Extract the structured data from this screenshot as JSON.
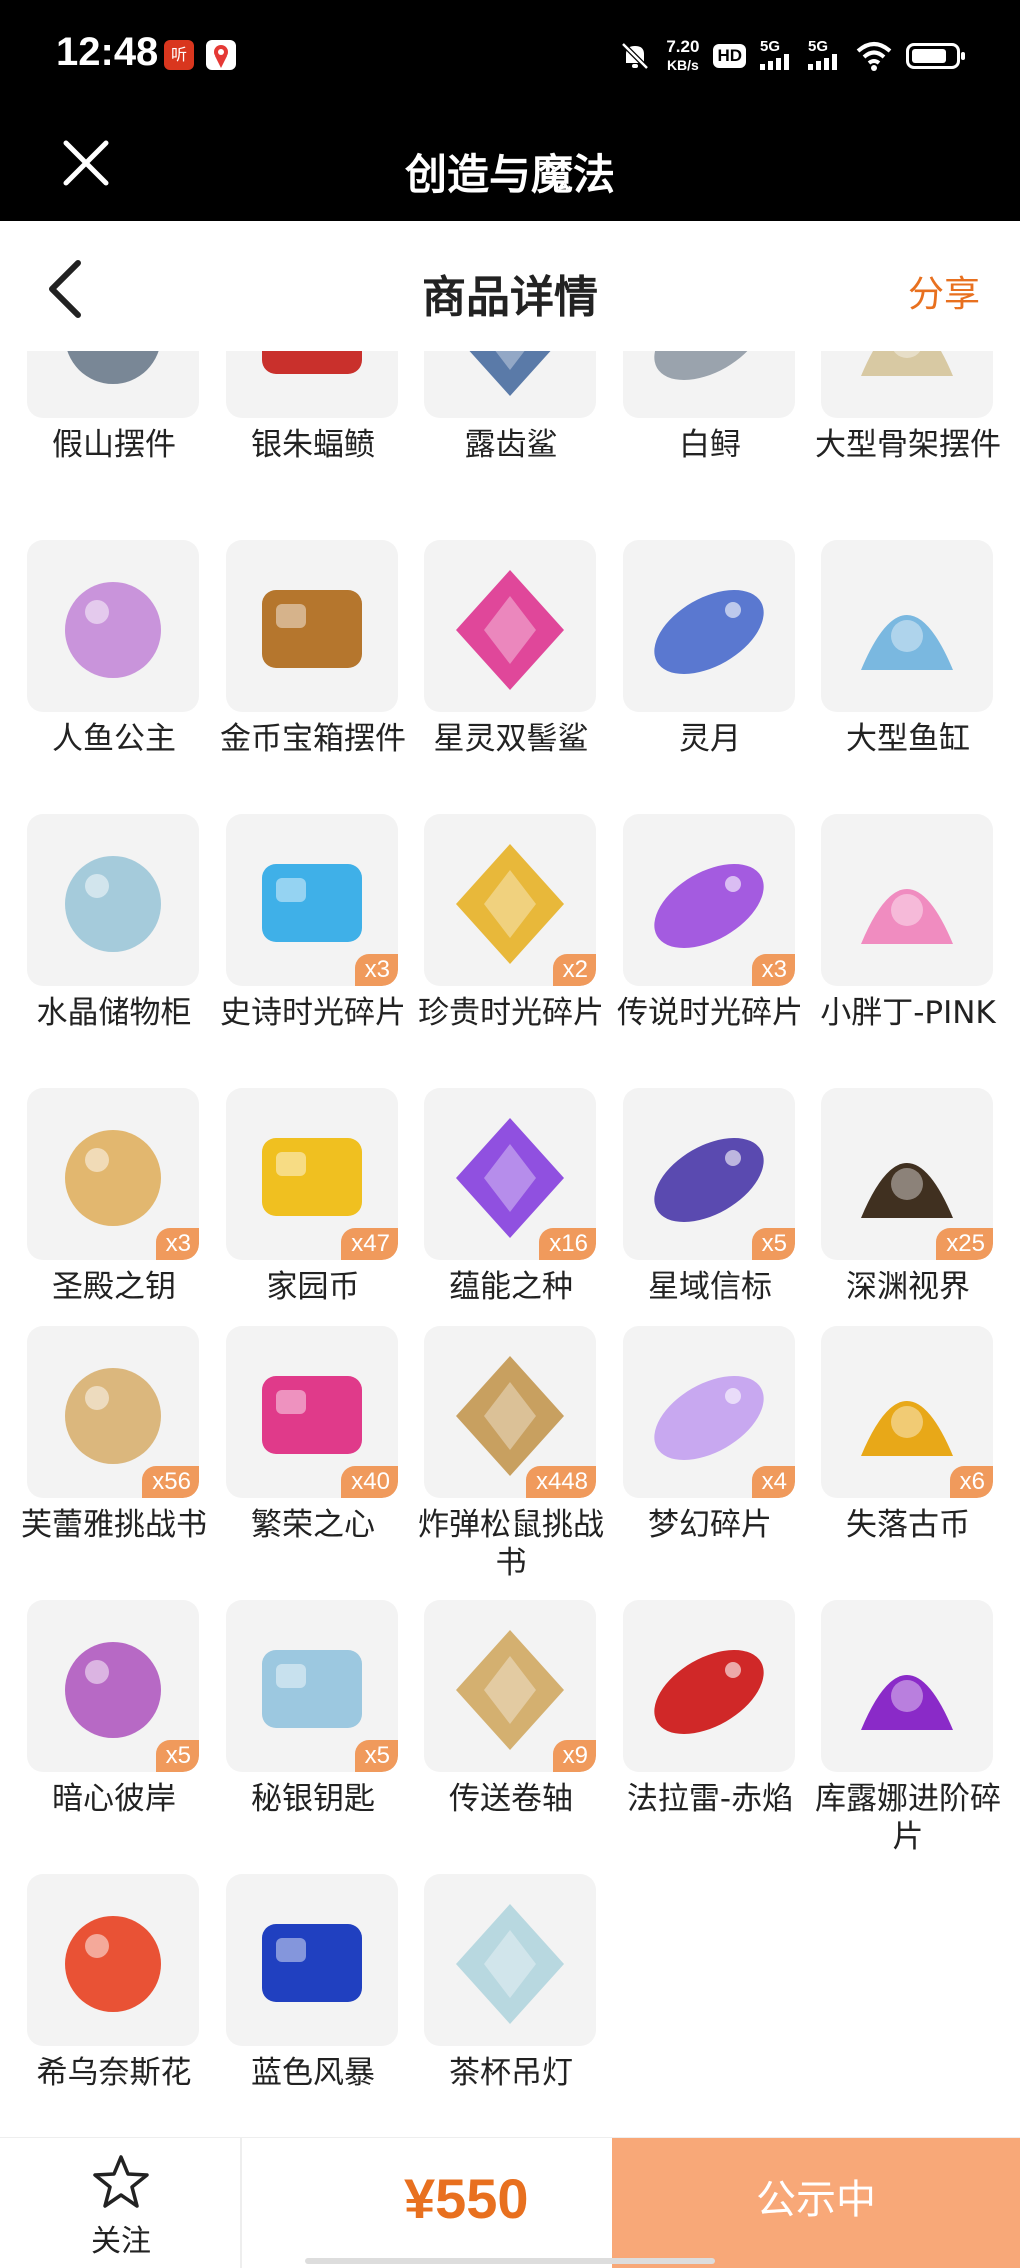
{
  "status_bar": {
    "time": "12:48",
    "net_speed_value": "7.20",
    "net_speed_unit": "KB/s",
    "hd_label": "HD",
    "signal_labels": [
      "5G",
      "5G"
    ],
    "icons": [
      "app-notification-icon",
      "maps-notification-icon",
      "mute-bell-icon",
      "wifi-icon",
      "battery-icon"
    ]
  },
  "app_bar": {
    "title": "创造与魔法"
  },
  "header": {
    "title": "商品详情",
    "share_label": "分享"
  },
  "items": [
    {
      "name": "假山摆件",
      "qty": ""
    },
    {
      "name": "银朱蝠鲼",
      "qty": ""
    },
    {
      "name": "露齿鲨",
      "qty": ""
    },
    {
      "name": "白鲟",
      "qty": ""
    },
    {
      "name": "大型骨架摆件",
      "qty": ""
    },
    {
      "name": "人鱼公主",
      "qty": ""
    },
    {
      "name": "金币宝箱摆件",
      "qty": ""
    },
    {
      "name": "星灵双髻鲨",
      "qty": ""
    },
    {
      "name": "灵月",
      "qty": ""
    },
    {
      "name": "大型鱼缸",
      "qty": ""
    },
    {
      "name": "水晶储物柜",
      "qty": ""
    },
    {
      "name": "史诗时光碎片",
      "qty": "x3"
    },
    {
      "name": "珍贵时光碎片",
      "qty": "x2"
    },
    {
      "name": "传说时光碎片",
      "qty": "x3"
    },
    {
      "name": "小胖丁-PINK",
      "qty": ""
    },
    {
      "name": "圣殿之钥",
      "qty": "x3"
    },
    {
      "name": "家园币",
      "qty": "x47"
    },
    {
      "name": "蕴能之种",
      "qty": "x16"
    },
    {
      "name": "星域信标",
      "qty": "x5"
    },
    {
      "name": "深渊视界",
      "qty": "x25"
    },
    {
      "name": "芙蕾雅挑战书",
      "qty": "x56"
    },
    {
      "name": "繁荣之心",
      "qty": "x40"
    },
    {
      "name": "炸弹松鼠挑战书",
      "qty": "x448"
    },
    {
      "name": "梦幻碎片",
      "qty": "x4"
    },
    {
      "name": "失落古币",
      "qty": "x6"
    },
    {
      "name": "暗心彼岸",
      "qty": "x5"
    },
    {
      "name": "秘银钥匙",
      "qty": "x5"
    },
    {
      "name": "传送卷轴",
      "qty": "x9"
    },
    {
      "name": "法拉雷-赤焰",
      "qty": ""
    },
    {
      "name": "库露娜进阶碎片",
      "qty": ""
    },
    {
      "name": "希乌奈斯花",
      "qty": ""
    },
    {
      "name": "蓝色风暴",
      "qty": ""
    },
    {
      "name": "茶杯吊灯",
      "qty": ""
    }
  ],
  "bottom_bar": {
    "follow_label": "关注",
    "price": "¥550",
    "cta_label": "公示中"
  },
  "colors": {
    "accent": "#e8701f",
    "badge": "#f09a5c",
    "cta": "#f8a878",
    "tile": "#f3f3f3"
  }
}
